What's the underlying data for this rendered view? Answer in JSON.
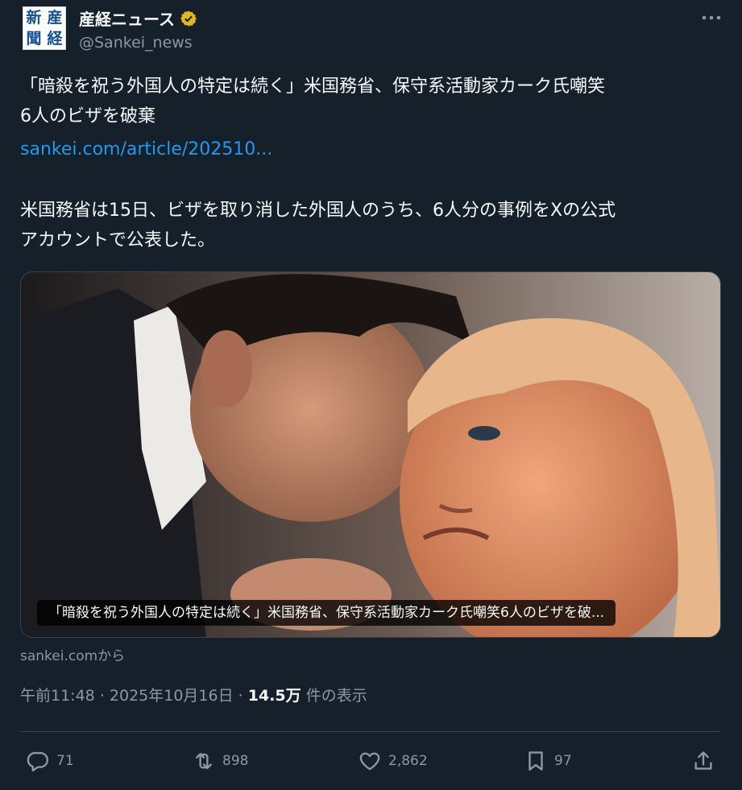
{
  "account": {
    "logo_chars": [
      "新",
      "産",
      "聞",
      "経"
    ],
    "display_name": "産経ニュース",
    "handle": "@Sankei_news"
  },
  "post": {
    "headline_line1": "「暗殺を祝う外国人の特定は続く」米国務省、保守系活動家カーク氏嘲笑",
    "headline_line2": "6人のビザを破棄",
    "link_text": "sankei.com/article/202510...",
    "body_line1": "米国務省は15日、ビザを取り消した外国人のうち、6人分の事例をXの公式",
    "body_line2": "アカウントで公表した。"
  },
  "card": {
    "caption": "「暗殺を祝う外国人の特定は続く」米国務省、保守系活動家カーク氏嘲笑6人のビザを破...",
    "source": "sankei.comから"
  },
  "meta": {
    "time": "午前11:48",
    "separator": "·",
    "date": "2025年10月16日",
    "views": "14.5万",
    "views_label": "件の表示"
  },
  "actions": {
    "replies": "71",
    "reposts": "898",
    "likes": "2,862",
    "bookmarks": "97"
  },
  "colors": {
    "background": "#15202b",
    "accent": "#1d9bf0",
    "verified_badge": "#e2b719",
    "muted_text": "#8b98a5"
  },
  "icons": [
    "verified-badge-icon",
    "more-icon",
    "reply-icon",
    "repost-icon",
    "like-icon",
    "bookmark-icon",
    "share-icon"
  ]
}
